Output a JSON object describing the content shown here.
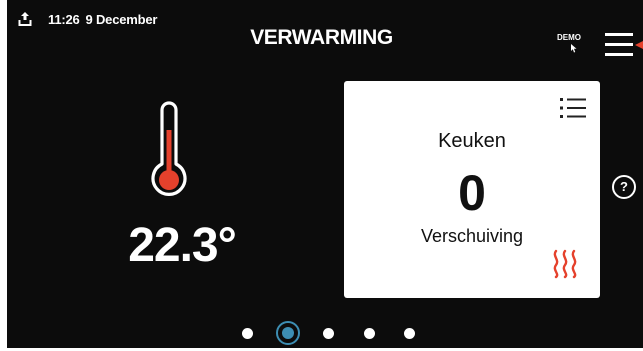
{
  "status_bar": {
    "time": "11:26",
    "date": "9 December",
    "icons": {
      "upload": "upload-icon"
    }
  },
  "header": {
    "title": "VERWARMING",
    "demo_label": "DEMO",
    "menu_icon": "hamburger-menu-icon"
  },
  "main": {
    "current_temperature": "22.3°",
    "thermometer_icon": "thermometer-icon"
  },
  "zone_card": {
    "name": "Keuken",
    "value": "0",
    "label": "Verschuiving",
    "list_icon": "list-icon",
    "status_icon": "heating-icon"
  },
  "help": {
    "label": "?"
  },
  "pager": {
    "pages": 5,
    "active_index": 1
  },
  "colors": {
    "background": "#0c0c0c",
    "accent_red": "#e5412c",
    "accent_blue": "#3d8eb3",
    "card": "#ffffff",
    "text_light": "#ffffff"
  }
}
